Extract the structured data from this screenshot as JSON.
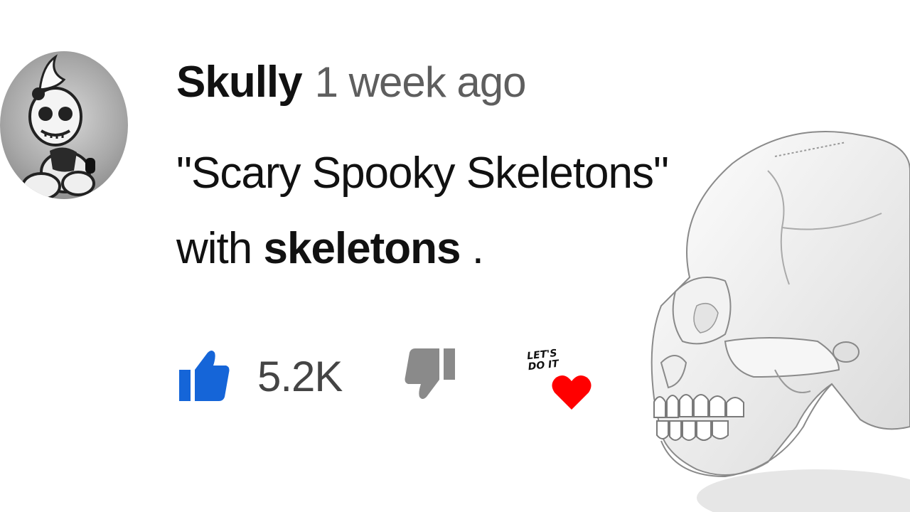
{
  "comment": {
    "author": "Skully",
    "timestamp": "1 week ago",
    "text_line1": "\"Scary Spooky Skeletons\"",
    "text_line2_prefix": "with ",
    "text_line2_bold": "skeletons",
    "text_line2_suffix": " ."
  },
  "actions": {
    "like_count": "5.2K",
    "like_icon": "thumbs-up-icon",
    "dislike_icon": "thumbs-down-icon",
    "heart_icon": "heart-icon",
    "heart_badge_text_1": "LET'S",
    "heart_badge_text_2": "DO IT"
  },
  "colors": {
    "like_active": "#1565d8",
    "dislike": "#8a8a8a",
    "heart": "#ff0000",
    "timestamp": "#5e5e5e"
  }
}
